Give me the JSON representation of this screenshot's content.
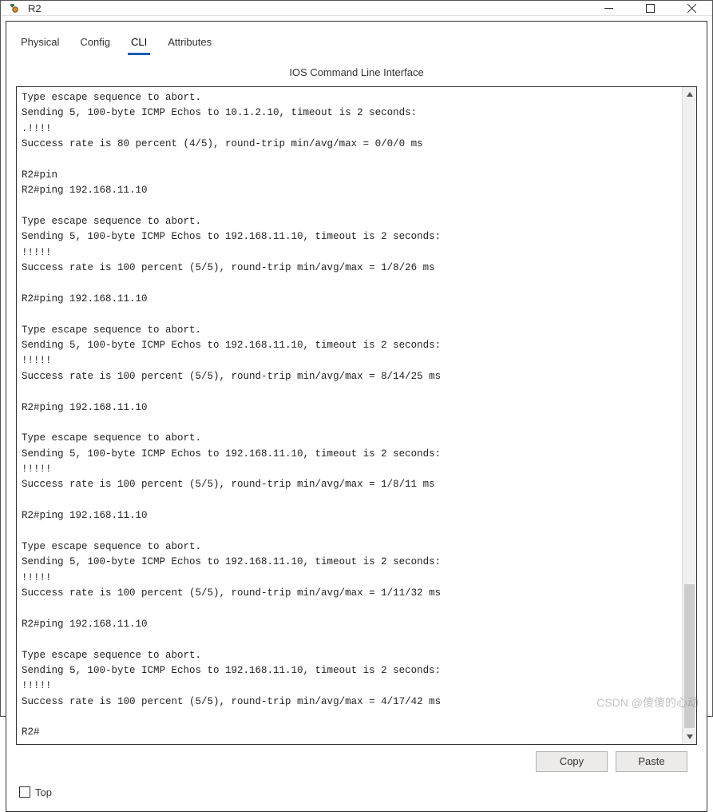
{
  "window": {
    "title": "R2"
  },
  "tabs": {
    "physical": "Physical",
    "config": "Config",
    "cli": "CLI",
    "attributes": "Attributes"
  },
  "cli_title": "IOS Command Line Interface",
  "terminal_output": "Type escape sequence to abort.\nSending 5, 100-byte ICMP Echos to 10.1.2.10, timeout is 2 seconds:\n.!!!!\nSuccess rate is 80 percent (4/5), round-trip min/avg/max = 0/0/0 ms\n\nR2#pin\nR2#ping 192.168.11.10\n\nType escape sequence to abort.\nSending 5, 100-byte ICMP Echos to 192.168.11.10, timeout is 2 seconds:\n!!!!!\nSuccess rate is 100 percent (5/5), round-trip min/avg/max = 1/8/26 ms\n\nR2#ping 192.168.11.10\n\nType escape sequence to abort.\nSending 5, 100-byte ICMP Echos to 192.168.11.10, timeout is 2 seconds:\n!!!!!\nSuccess rate is 100 percent (5/5), round-trip min/avg/max = 8/14/25 ms\n\nR2#ping 192.168.11.10\n\nType escape sequence to abort.\nSending 5, 100-byte ICMP Echos to 192.168.11.10, timeout is 2 seconds:\n!!!!!\nSuccess rate is 100 percent (5/5), round-trip min/avg/max = 1/8/11 ms\n\nR2#ping 192.168.11.10\n\nType escape sequence to abort.\nSending 5, 100-byte ICMP Echos to 192.168.11.10, timeout is 2 seconds:\n!!!!!\nSuccess rate is 100 percent (5/5), round-trip min/avg/max = 1/11/32 ms\n\nR2#ping 192.168.11.10\n\nType escape sequence to abort.\nSending 5, 100-byte ICMP Echos to 192.168.11.10, timeout is 2 seconds:\n!!!!!\nSuccess rate is 100 percent (5/5), round-trip min/avg/max = 4/17/42 ms\n\nR2#",
  "buttons": {
    "copy": "Copy",
    "paste": "Paste"
  },
  "footer": {
    "top_label": "Top"
  },
  "watermark": "CSDN @傻傻的心动"
}
